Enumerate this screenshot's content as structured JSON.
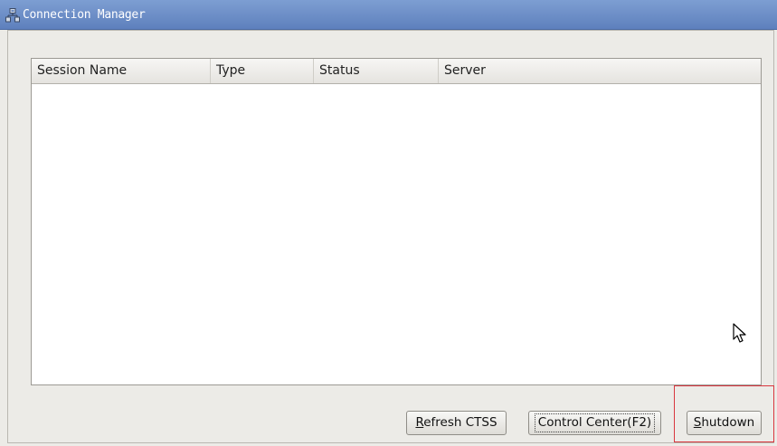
{
  "window": {
    "title": "Connection Manager",
    "icon": "network-computer-icon"
  },
  "table": {
    "columns": [
      "Session Name",
      "Type",
      "Status",
      "Server"
    ],
    "rows": []
  },
  "buttons": {
    "refresh": {
      "mnemonic": "R",
      "rest": "efresh CTSS"
    },
    "control_center": {
      "label": "Control Center(F2)"
    },
    "shutdown": {
      "mnemonic": "S",
      "rest": "hutdown"
    }
  },
  "annotation": {
    "highlight_color": "#d9363e",
    "highlighted_element": "shutdown-button"
  }
}
